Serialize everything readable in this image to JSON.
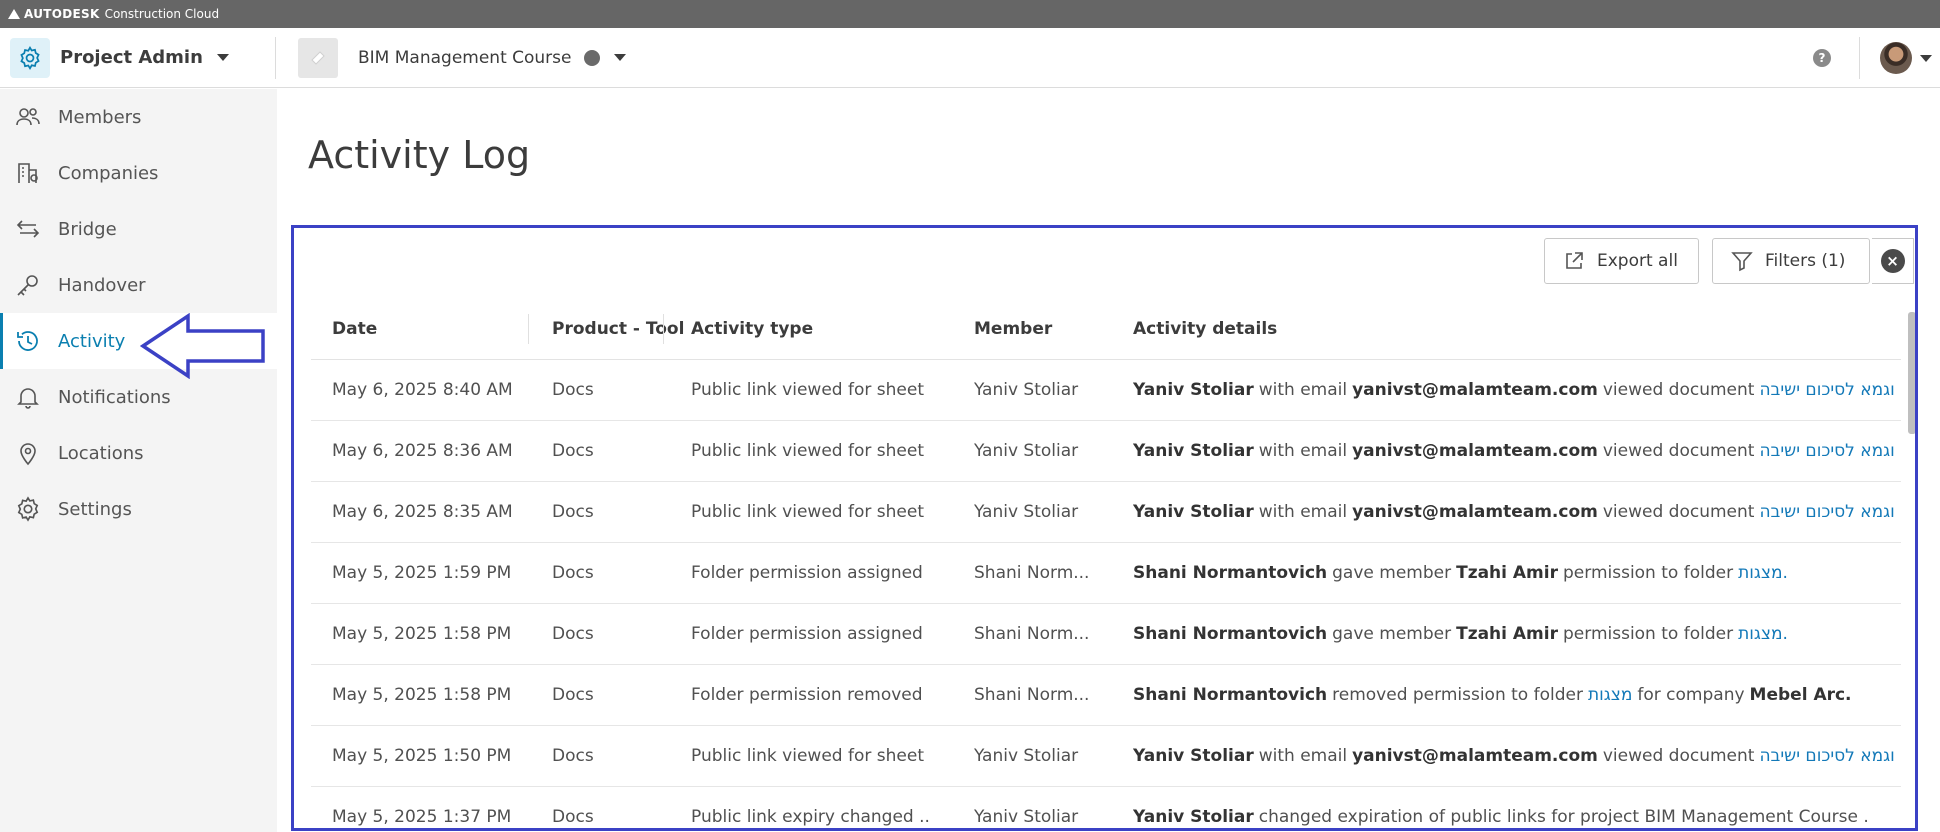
{
  "topbar": {
    "brand": "AUTODESK",
    "brand_sub": "Construction Cloud"
  },
  "header": {
    "module_title": "Project Admin",
    "project_name": "BIM Management Course",
    "help_label": "?"
  },
  "sidebar": {
    "items": [
      {
        "label": "Members",
        "icon": "members-icon"
      },
      {
        "label": "Companies",
        "icon": "companies-icon"
      },
      {
        "label": "Bridge",
        "icon": "bridge-icon"
      },
      {
        "label": "Handover",
        "icon": "key-icon"
      },
      {
        "label": "Activity",
        "icon": "history-icon",
        "active": true
      },
      {
        "label": "Notifications",
        "icon": "bell-icon"
      },
      {
        "label": "Locations",
        "icon": "location-pin-icon"
      },
      {
        "label": "Settings",
        "icon": "gear-icon"
      }
    ]
  },
  "page": {
    "title": "Activity Log"
  },
  "toolbar": {
    "export_label": "Export all",
    "filters_label": "Filters (1)"
  },
  "colors": {
    "accent": "#0a7fb0",
    "annotation": "#3b41c5",
    "link": "#1379b8"
  },
  "table": {
    "columns": [
      "Date",
      "Product - Tool",
      "Activity type",
      "Member",
      "Activity details"
    ],
    "rows": [
      {
        "date": "May 6, 2025 8:40 AM",
        "product": "Docs",
        "type": "Public link viewed for sheet",
        "member": "Yaniv Stoliar",
        "d1": "Yaniv Stoliar",
        "d2": "with email",
        "d3": "yanivst@malamteam.com",
        "d4": "viewed document",
        "d5": "דוגמא לסיכום ישיבה...."
      },
      {
        "date": "May 6, 2025 8:36 AM",
        "product": "Docs",
        "type": "Public link viewed for sheet",
        "member": "Yaniv Stoliar",
        "d1": "Yaniv Stoliar",
        "d2": "with email",
        "d3": "yanivst@malamteam.com",
        "d4": "viewed document",
        "d5": "דוגמא לסיכום ישיבה...."
      },
      {
        "date": "May 6, 2025 8:35 AM",
        "product": "Docs",
        "type": "Public link viewed for sheet",
        "member": "Yaniv Stoliar",
        "d1": "Yaniv Stoliar",
        "d2": "with email",
        "d3": "yanivst@malamteam.com",
        "d4": "viewed document",
        "d5": "דוגמא לסיכום ישיבה...."
      },
      {
        "date": "May 5, 2025 1:59 PM",
        "product": "Docs",
        "type": "Folder permission assigned",
        "member": "Shani Norm...",
        "d1": "Shani Normantovich",
        "d2": "gave member",
        "d3": "Tzahi Amir",
        "d4": "permission to folder",
        "d5": "מצגות."
      },
      {
        "date": "May 5, 2025 1:58 PM",
        "product": "Docs",
        "type": "Folder permission assigned",
        "member": "Shani Norm...",
        "d1": "Shani Normantovich",
        "d2": "gave member",
        "d3": "Tzahi Amir",
        "d4": "permission to folder",
        "d5": "מצגות."
      },
      {
        "date": "May 5, 2025 1:58 PM",
        "product": "Docs",
        "type": "Folder permission removed",
        "member": "Shani Norm...",
        "d1": "Shani Normantovich",
        "d2": "removed permission to folder",
        "d3": "מצגות",
        "d4": "for company",
        "d5": "Mebel Arc."
      },
      {
        "date": "May 5, 2025 1:50 PM",
        "product": "Docs",
        "type": "Public link viewed for sheet",
        "member": "Yaniv Stoliar",
        "d1": "Yaniv Stoliar",
        "d2": "with email",
        "d3": "yanivst@malamteam.com",
        "d4": "viewed document",
        "d5": "דוגמא לסיכום ישיבה...."
      },
      {
        "date": "May 5, 2025 1:37 PM",
        "product": "Docs",
        "type": "Public link expiry changed ...",
        "member": "Yaniv Stoliar",
        "d1": "Yaniv Stoliar",
        "d2": "changed expiration of public links for project BIM Management Course .",
        "d3": "",
        "d4": "",
        "d5": ""
      }
    ]
  }
}
